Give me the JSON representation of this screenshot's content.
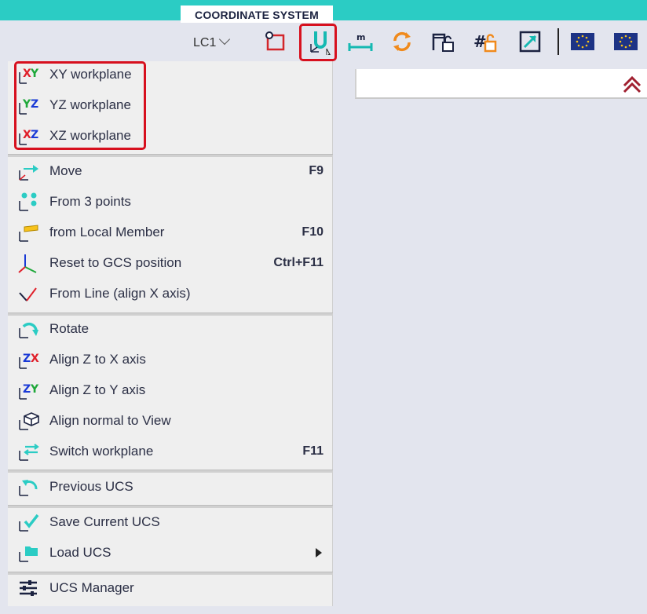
{
  "header": {
    "section_title": "COORDINATE SYSTEM"
  },
  "toolbar": {
    "load_case": "LC1",
    "icons": [
      "rectangle-select-icon",
      "ucs-icon",
      "measure-icon",
      "refresh-icon",
      "lock-member-icon",
      "lock-grid-icon",
      "fit-view-icon",
      "stars-flag-icon",
      "stars-flag-icon"
    ],
    "measure_text": "m"
  },
  "menu": {
    "workplanes": [
      {
        "label": "XY workplane",
        "axes": [
          "X",
          "Y"
        ]
      },
      {
        "label": "YZ workplane",
        "axes": [
          "Y",
          "Z"
        ]
      },
      {
        "label": "XZ workplane",
        "axes": [
          "X",
          "Z"
        ]
      }
    ],
    "move_items": [
      {
        "label": "Move",
        "shortcut": "F9"
      },
      {
        "label": "From 3 points",
        "shortcut": ""
      },
      {
        "label": "from Local Member",
        "shortcut": "F10"
      },
      {
        "label": "Reset to GCS position",
        "shortcut": "Ctrl+F11"
      },
      {
        "label": "From Line (align X axis)",
        "shortcut": ""
      }
    ],
    "rotate_items": [
      {
        "label": "Rotate",
        "shortcut": ""
      },
      {
        "label": "Align Z to X axis",
        "shortcut": "",
        "axes": [
          "Z",
          "X"
        ]
      },
      {
        "label": "Align Z to Y axis",
        "shortcut": "",
        "axes": [
          "Z",
          "Y"
        ]
      },
      {
        "label": "Align normal to View",
        "shortcut": ""
      },
      {
        "label": "Switch workplane",
        "shortcut": "F11"
      }
    ],
    "previous": {
      "label": "Previous UCS"
    },
    "save_load": [
      {
        "label": "Save Current UCS"
      },
      {
        "label": "Load UCS"
      }
    ],
    "manager": {
      "label": "UCS Manager"
    }
  },
  "colors": {
    "accent": "#2bccc4",
    "highlight": "#d7101e",
    "x_axis": "#e0202a",
    "y_axis": "#1fa83a",
    "z_axis": "#1a3ad6"
  }
}
